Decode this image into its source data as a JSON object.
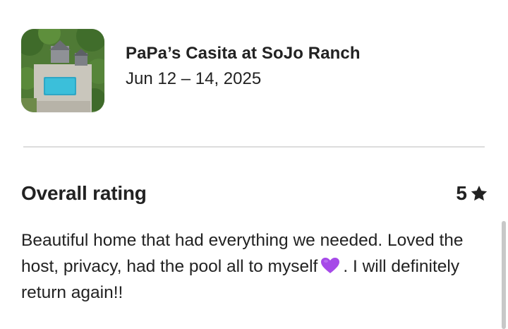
{
  "listing": {
    "title": "PaPa’s Casita at SoJo Ranch",
    "dates": "Jun 12 – 14, 2025",
    "thumbnail_icon": "listing-photo-pool-aerial"
  },
  "rating": {
    "title": "Overall rating",
    "value": "5",
    "icon": "star-icon"
  },
  "review": {
    "text_part1": "Beautiful home that had everything we needed. Loved the host, privacy, had the pool all to myself",
    "emoji": "purple-heart-icon",
    "text_part2": ". I will definitely return again!!"
  },
  "colors": {
    "text": "#222222",
    "divider": "#dddddd",
    "heart": "#a64ae8",
    "scrollbar": "#c8c8c8"
  }
}
